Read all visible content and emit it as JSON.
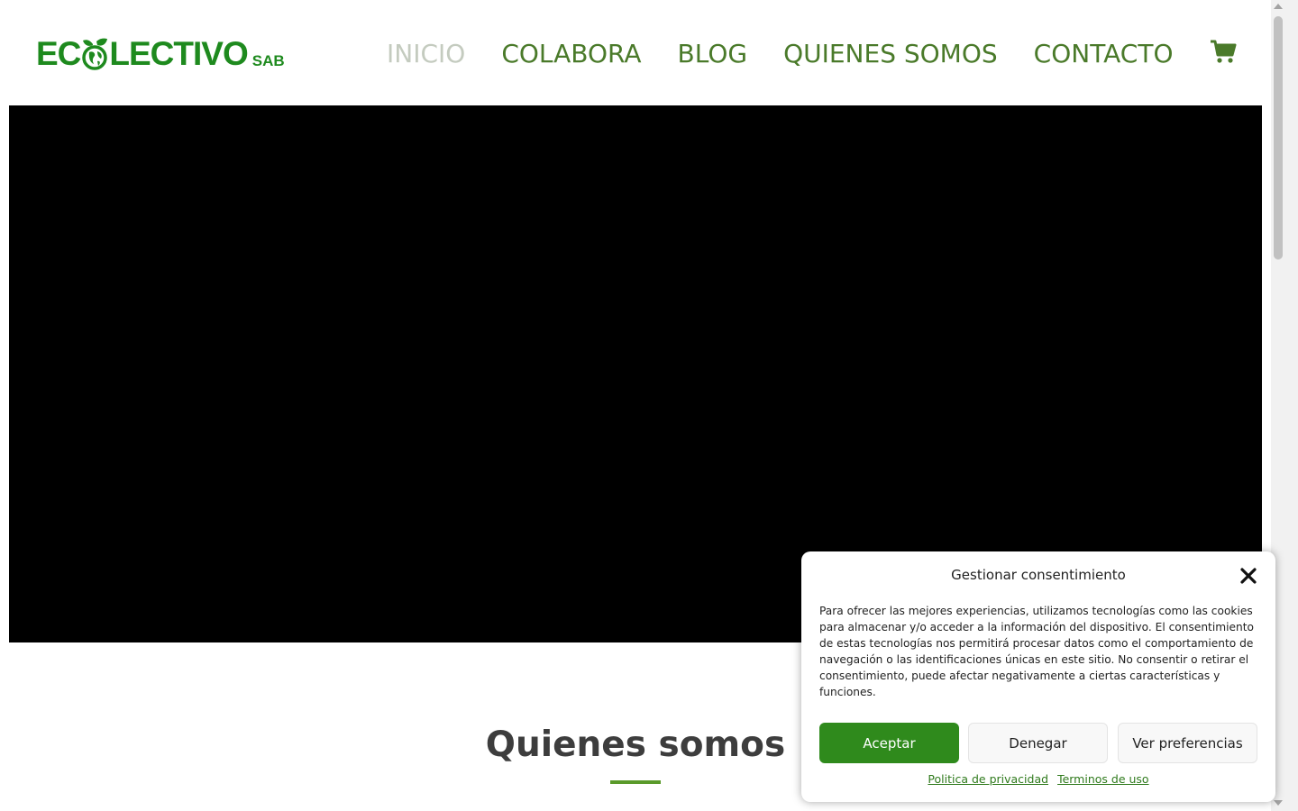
{
  "header": {
    "logo": {
      "text_before": "EC",
      "text_after": "LECTIVO",
      "suffix": "SAB"
    },
    "nav": [
      {
        "label": "INICIO",
        "active": true
      },
      {
        "label": "COLABORA",
        "active": false
      },
      {
        "label": "BLOG",
        "active": false
      },
      {
        "label": "QUIENES SOMOS",
        "active": false
      },
      {
        "label": "CONTACTO",
        "active": false
      }
    ],
    "cart_icon": "shopping-cart-icon"
  },
  "section": {
    "title": "Quienes somos"
  },
  "cookie_banner": {
    "title": "Gestionar consentimiento",
    "text": "Para ofrecer las mejores experiencias, utilizamos tecnologías como las cookies para almacenar y/o acceder a la información del dispositivo. El consentimiento de estas tecnologías nos permitirá procesar datos como el comportamiento de navegación o las identificaciones únicas en este sitio. No consentir o retirar el consentimiento, puede afectar negativamente a ciertas características y funciones.",
    "accept_label": "Aceptar",
    "deny_label": "Denegar",
    "preferences_label": "Ver preferencias",
    "privacy_link": "Politica de privacidad",
    "terms_link": "Terminos de uso"
  },
  "colors": {
    "brand_green": "#1e8a1e",
    "nav_green": "#4a7a2a",
    "nav_active": "#c4cbbf",
    "accept_green": "#2f8a1c"
  }
}
